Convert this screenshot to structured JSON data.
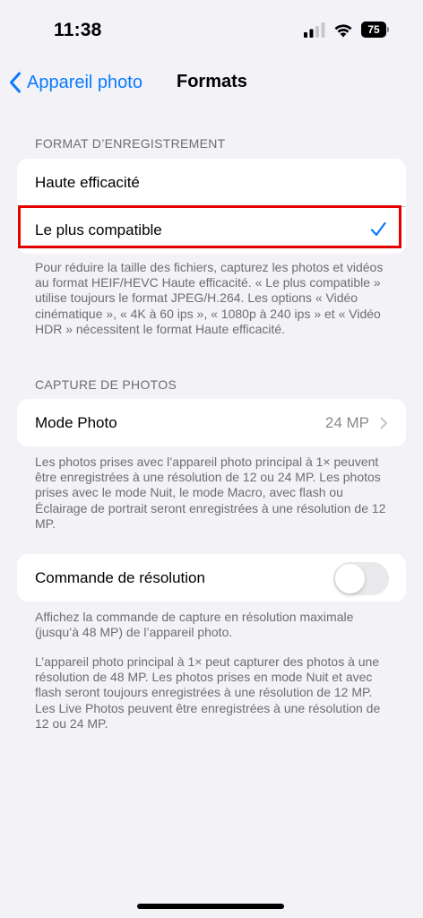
{
  "status_bar": {
    "time": "11:38",
    "battery_level": "75",
    "battery_percent": 75
  },
  "nav": {
    "back_label": "Appareil photo",
    "title": "Formats"
  },
  "format_section": {
    "header": "FORMAT D’ENREGISTREMENT",
    "options": [
      {
        "label": "Haute efficacité",
        "selected": false
      },
      {
        "label": "Le plus compatible",
        "selected": true
      }
    ],
    "footer": "Pour réduire la taille des fichiers, capturez les photos et vidéos au format HEIF/HEVC Haute efficacité. « Le plus compatible » utilise toujours le format JPEG/H.264. Les options « Vidéo cinématique », « 4K à 60 ips », « 1080p à 240 ips » et « Vidéo HDR » nécessitent le format Haute efficacité."
  },
  "capture_section": {
    "header": "CAPTURE DE PHOTOS",
    "mode_photo_label": "Mode Photo",
    "mode_photo_value": "24 MP",
    "footer": "Les photos prises avec l’appareil photo principal à 1× peuvent être enregistrées à une résolution de 12 ou 24 MP. Les photos prises avec le mode Nuit, le mode Macro, avec flash ou Éclairage de portrait seront enregistrées à une résolution de 12 MP."
  },
  "resolution_section": {
    "label": "Commande de résolution",
    "enabled": false,
    "footer_1": "Affichez la commande de capture en résolution maximale (jusqu’à 48 MP) de l’appareil photo.",
    "footer_2": "L’appareil photo principal à 1× peut capturer des photos à une résolution de 48 MP. Les photos prises en mode Nuit et avec flash seront toujours enregistrées à une résolution de 12 MP. Les Live Photos peuvent être enregistrées à une résolution de 12 ou 24 MP."
  },
  "colors": {
    "accent": "#0a7aff",
    "highlight": "#e50000",
    "background": "#f2f2f7"
  },
  "icons": {
    "back": "chevron-left-icon",
    "check": "checkmark-icon",
    "disclosure": "chevron-right-icon",
    "signal": "signal-icon",
    "wifi": "wifi-icon",
    "battery": "battery-icon"
  }
}
